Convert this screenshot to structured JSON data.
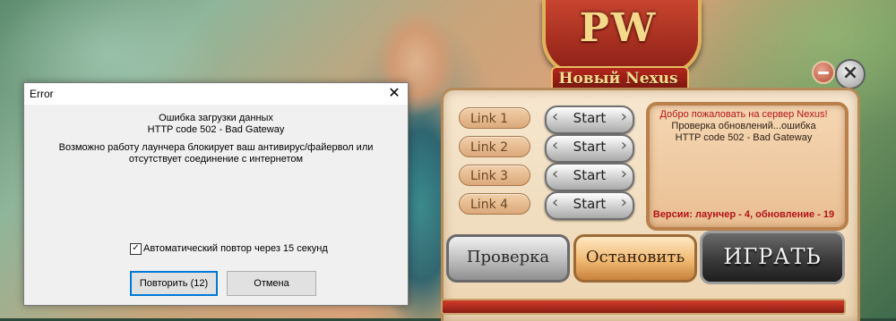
{
  "launcher": {
    "logo_title": "PW",
    "logo_subtitle": "Новый Nexus",
    "links": [
      {
        "label": "Link 1",
        "action": "Start"
      },
      {
        "label": "Link 2",
        "action": "Start"
      },
      {
        "label": "Link 3",
        "action": "Start"
      },
      {
        "label": "Link 4",
        "action": "Start"
      }
    ],
    "news": {
      "welcome": "Добро пожаловать на сервер Nexus!",
      "status": "Проверка обновлений...ошибка",
      "http": "HTTP code 502 - Bad Gateway"
    },
    "version": "Версии: лаунчер - 4, обновление - 19",
    "buttons": {
      "check": "Проверка",
      "stop": "Остановить",
      "play": "ИГРАТЬ"
    },
    "progress": 1.0
  },
  "dialog": {
    "title": "Error",
    "close_glyph": "✕",
    "message_line1": "Ошибка загрузки данных",
    "message_line2": "HTTP code 502 - Bad Gateway",
    "message_line3": "Возможно работу лаунчера блокирует ваш антивирус/файервол или отсутствует соединение с интернетом",
    "auto_retry_label": "Автоматический повтор через 15 секунд",
    "auto_retry_checked": true,
    "retry_button": "Повторить (12)",
    "cancel_button": "Отмена"
  }
}
